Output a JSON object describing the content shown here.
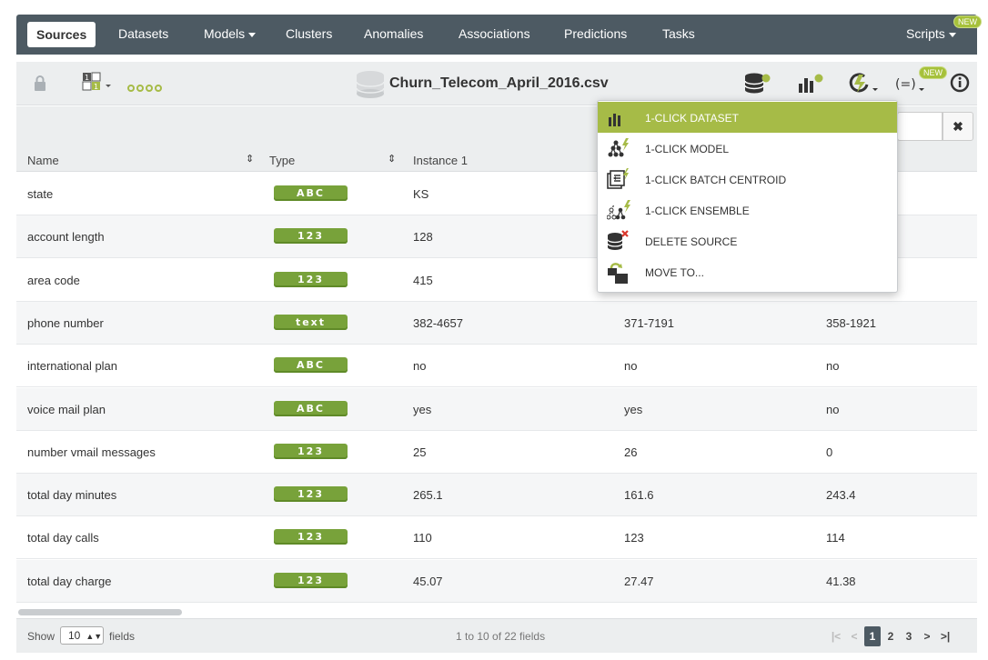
{
  "nav": {
    "items": [
      {
        "label": "Sources",
        "active": true
      },
      {
        "label": "Datasets"
      },
      {
        "label": "Models",
        "dropdown": true
      },
      {
        "label": "Clusters"
      },
      {
        "label": "Anomalies"
      },
      {
        "label": "Associations"
      },
      {
        "label": "Predictions"
      },
      {
        "label": "Tasks"
      },
      {
        "label": "Scripts",
        "dropdown": true,
        "badge": "NEW"
      }
    ]
  },
  "toolbar": {
    "filename": "Churn_Telecom_April_2016.csv",
    "new_badge": "NEW",
    "icons": [
      "lock-icon",
      "source-config-icon",
      "dots-icon",
      "database-icon",
      "dataset-icon",
      "model-icon",
      "one-click-menu-icon",
      "formula-icon",
      "info-icon"
    ]
  },
  "dropdown": {
    "items": [
      {
        "label": "1-CLICK DATASET",
        "icon": "dataset-bolt-icon",
        "highlighted": true
      },
      {
        "label": "1-CLICK MODEL",
        "icon": "model-bolt-icon"
      },
      {
        "label": "1-CLICK BATCH CENTROID",
        "icon": "batch-centroid-bolt-icon"
      },
      {
        "label": "1-CLICK ENSEMBLE",
        "icon": "ensemble-bolt-icon"
      },
      {
        "label": "DELETE SOURCE",
        "icon": "delete-source-icon"
      },
      {
        "label": "MOVE TO...",
        "icon": "move-to-icon"
      }
    ]
  },
  "table": {
    "headers": [
      "Name",
      "Type",
      "Instance 1"
    ],
    "rows": [
      {
        "name": "state",
        "type": "ABC",
        "i1": "KS",
        "i2": "",
        "i3": ""
      },
      {
        "name": "account length",
        "type": "123",
        "i1": "128",
        "i2": "",
        "i3": ""
      },
      {
        "name": "area code",
        "type": "123",
        "i1": "415",
        "i2": "",
        "i3": ""
      },
      {
        "name": "phone number",
        "type": "text",
        "i1": "382-4657",
        "i2": "371-7191",
        "i3": "358-1921"
      },
      {
        "name": "international plan",
        "type": "ABC",
        "i1": "no",
        "i2": "no",
        "i3": "no"
      },
      {
        "name": "voice mail plan",
        "type": "ABC",
        "i1": "yes",
        "i2": "yes",
        "i3": "no"
      },
      {
        "name": "number vmail messages",
        "type": "123",
        "i1": "25",
        "i2": "26",
        "i3": "0"
      },
      {
        "name": "total day minutes",
        "type": "123",
        "i1": "265.1",
        "i2": "161.6",
        "i3": "243.4"
      },
      {
        "name": "total day calls",
        "type": "123",
        "i1": "110",
        "i2": "123",
        "i3": "114"
      },
      {
        "name": "total day charge",
        "type": "123",
        "i1": "45.07",
        "i2": "27.47",
        "i3": "41.38"
      }
    ]
  },
  "search": {
    "value": ""
  },
  "footer": {
    "show_label": "Show",
    "show_value": "10",
    "fields_label": "fields",
    "page_info": "1 to 10 of 22 fields",
    "pages": [
      "1",
      "2",
      "3"
    ]
  },
  "colors": {
    "nav_bg": "#4d5a63",
    "accent_green": "#a6bb47",
    "badge_green": "#78a23a"
  }
}
